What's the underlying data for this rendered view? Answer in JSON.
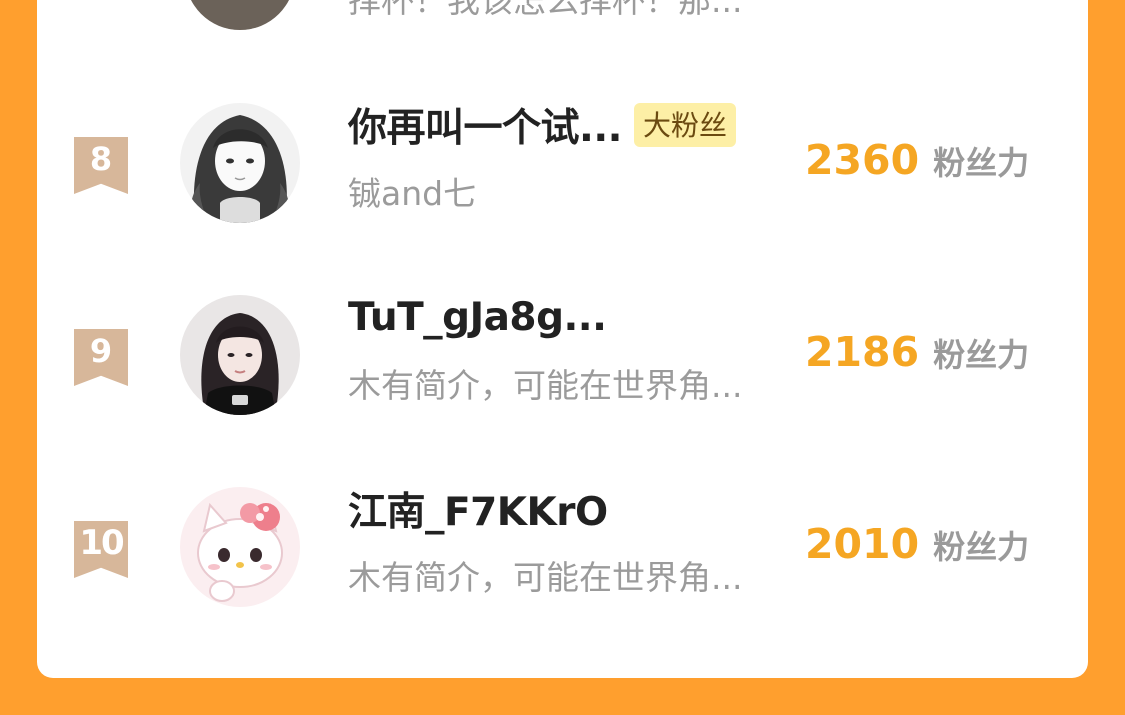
{
  "partial_row": {
    "subtitle": "择杯！我该怎么择杯！那..."
  },
  "rows": [
    {
      "rank": "8",
      "name": "你再叫一个试...",
      "badge": "大粉丝",
      "subtitle": "铖and七",
      "score": "2360",
      "unit": "粉丝力",
      "avatar": "anime-girl-avatar"
    },
    {
      "rank": "9",
      "name": "TuT_gJa8g...",
      "badge": "",
      "subtitle": "木有简介，可能在世界角...",
      "score": "2186",
      "unit": "粉丝力",
      "avatar": "girl-photo-avatar"
    },
    {
      "rank": "10",
      "name": "江南_F7KKrO",
      "badge": "",
      "subtitle": "木有简介，可能在世界角...",
      "score": "2010",
      "unit": "粉丝力",
      "avatar": "hello-kitty-avatar"
    }
  ],
  "colors": {
    "background": "#FF9F2E",
    "score": "#F5A623",
    "rank_ribbon": "#D7B79A",
    "badge_bg": "#FDEFA6"
  }
}
